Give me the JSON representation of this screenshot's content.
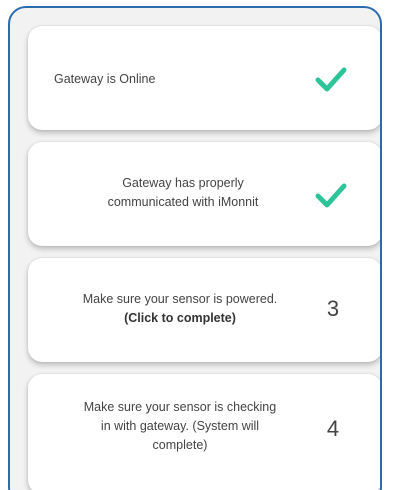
{
  "steps": [
    {
      "text": "Gateway is Online",
      "status": "complete",
      "status_icon": "check-icon"
    },
    {
      "text_line1": "Gateway has properly",
      "text_line2": "communicated with iMonnit",
      "status": "complete",
      "status_icon": "check-icon"
    },
    {
      "text_line1": "Make sure your sensor is powered.",
      "text_line2": "(Click to complete)",
      "number": "3"
    },
    {
      "text_line1": "Make sure your sensor is checking",
      "text_line2": "in with gateway. (System will",
      "text_line3": "complete)",
      "number": "4"
    }
  ],
  "colors": {
    "frame_border": "#2b6cb0",
    "check": "#2fc39a",
    "background": "#f2f2f2"
  }
}
